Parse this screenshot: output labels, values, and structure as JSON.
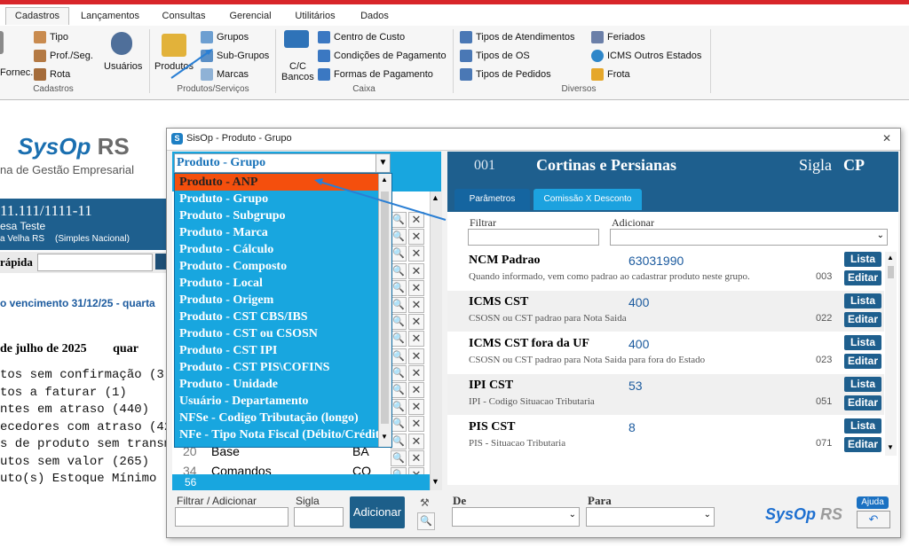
{
  "ribbon": {
    "tabs": [
      "Cadastros",
      "Lançamentos",
      "Consultas",
      "Gerencial",
      "Utilitários",
      "Dados"
    ],
    "active_tab": "Cadastros",
    "cadastros": {
      "fornec": "Fornec.",
      "tipo": "Tipo",
      "prof_seg": "Prof./Seg.",
      "rota": "Rota",
      "usuarios": "Usuários",
      "group_label": "Cadastros"
    },
    "produtos": {
      "produtos": "Produtos",
      "grupos": "Grupos",
      "subgrupos": "Sub-Grupos",
      "marcas": "Marcas",
      "group_label": "Produtos/Serviços"
    },
    "caixa": {
      "cc_bancos_1": "C/C",
      "cc_bancos_2": "Bancos",
      "centro_custo": "Centro de Custo",
      "condicoes": "Condições de Pagamento",
      "formas": "Formas de Pagamento",
      "group_label": "Caixa"
    },
    "diversos": {
      "tipos_atend": "Tipos de Atendimentos",
      "tipos_os": "Tipos de OS",
      "tipos_pedidos": "Tipos de Pedidos",
      "feriados": "Feriados",
      "icms": "ICMS Outros Estados",
      "frota": "Frota",
      "group_label": "Diversos"
    }
  },
  "background": {
    "logo_main": "SysOp",
    "logo_rs": " RS",
    "logo_sub": "na de Gestão Empresarial",
    "company_id": "11.111/1111-11",
    "company_name": "esa Teste",
    "company_city": "a Velha RS",
    "company_regime": "(Simples Nacional)",
    "quick_label": "rápida",
    "vencimento": "o vencimento 31/12/25 - quarta",
    "date": "de julho de 2025",
    "weekday": "quar",
    "todo_lines": [
      "tos sem confirmação (3)",
      "tos a faturar (1)",
      "ntes em atraso (440)",
      "ecedores com atraso (42",
      "s de produto sem transm",
      "utos sem valor (265)",
      "uto(s) Estoque Mínimo ("
    ]
  },
  "modal": {
    "title": "SisOp - Produto - Grupo",
    "selected_option": "Produto - Grupo",
    "dropdown_options": [
      "Produto - ANP",
      "Produto - Grupo",
      "Produto - Subgrupo",
      "Produto - Marca",
      "Produto - Cálculo",
      "Produto - Composto",
      "Produto - Local",
      "Produto - Origem",
      "Produto - CST CBS/IBS",
      "Produto - CST ou CSOSN",
      "Produto - CST IPI",
      "Produto - CST PIS\\COFINS",
      "Produto - Unidade",
      "Usuário - Departamento",
      "NFSe - Codigo Tributação (longo)",
      "NFe - Tipo Nota Fiscal (Débito/Crédito)"
    ],
    "list_rows": [
      {
        "num": "20",
        "name": "Base",
        "sigla": "BA"
      },
      {
        "num": "34",
        "name": "Comandos",
        "sigla": "CO"
      }
    ],
    "list_footer": "56",
    "filter_label": "Filtrar / Adicionar",
    "sigla_label": "Sigla",
    "add_button": "Adicionar",
    "de_label": "De",
    "para_label": "Para",
    "ajuda": "Ajuda"
  },
  "detail": {
    "code": "001",
    "name": "Cortinas e Persianas",
    "sigla_label": "Sigla",
    "sigla": "CP",
    "tabs": [
      "Parâmetros",
      "Comissão X Desconto"
    ],
    "filtrar_label": "Filtrar",
    "adicionar_label": "Adicionar",
    "lista_label": "Lista",
    "editar_label": "Editar",
    "fields": [
      {
        "title": "NCM Padrao",
        "value": "63031990",
        "desc": "Quando informado, vem como padrao ao cadastrar produto neste grupo.",
        "code": "003"
      },
      {
        "title": "ICMS CST",
        "value": "400",
        "desc": "CSOSN ou CST padrao para Nota Saida",
        "code": "022"
      },
      {
        "title": "ICMS CST fora da UF",
        "value": "400",
        "desc": "CSOSN ou CST padrao para Nota Saida para fora do Estado",
        "code": "023"
      },
      {
        "title": "IPI CST",
        "value": "53",
        "desc": "IPI - Codigo Situacao Tributaria",
        "code": "051"
      },
      {
        "title": "PIS CST",
        "value": "8",
        "desc": "PIS - Situacao Tributaria",
        "code": "071"
      }
    ],
    "brand": "SysOp",
    "brand_rs": " RS"
  }
}
